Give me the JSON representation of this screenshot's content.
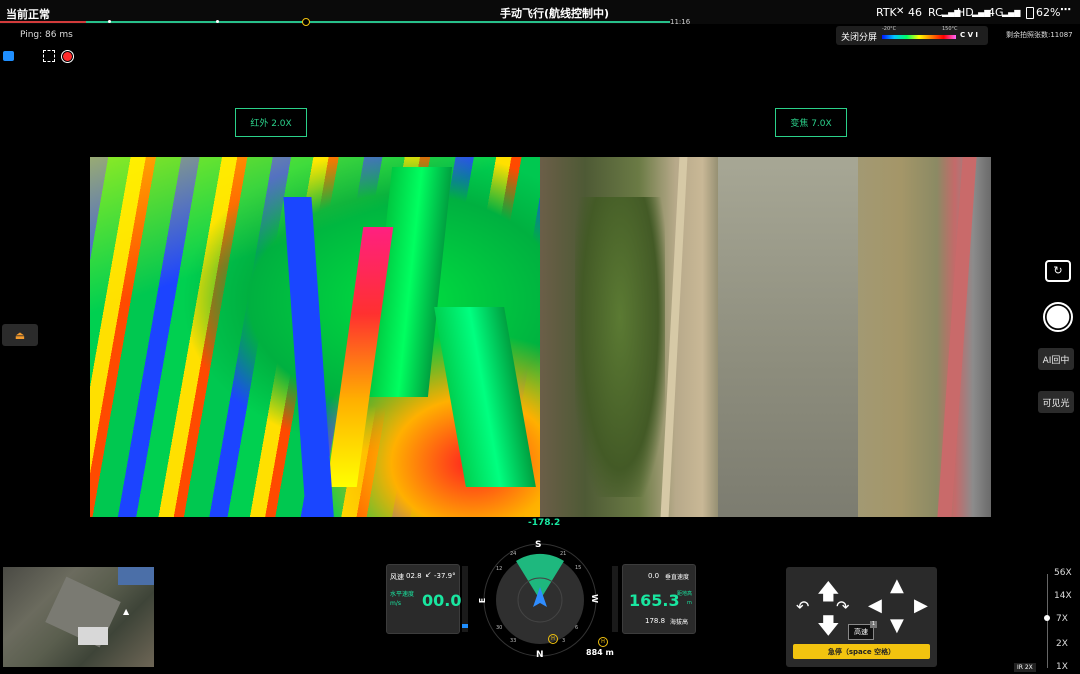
{
  "status_bar": {
    "status": "当前正常",
    "mode_title": "手动飞行(航线控制中)",
    "time_tag": "11:16",
    "rtk_label": "RTK",
    "rtk_count": "46",
    "rc_label": "RC",
    "hd_label": "HD",
    "net_label": "4G",
    "battery": "62%",
    "menu_icon": "more-dots-icon"
  },
  "ping": "Ping: 86 ms",
  "split_toggle": "关闭分屏",
  "temp_scale": {
    "min": "-20°C",
    "max": "150°C",
    "suffix": "C V I"
  },
  "remaining_shots": "剩余拍照张数:11087",
  "left_tools": {
    "camera_icon": "camera-icon",
    "focus_icon": "focus-frame-icon",
    "record_icon": "record-icon"
  },
  "ir_label": "红外 2.0X",
  "zoom_label": "变焦 7.0X",
  "right_controls": {
    "switch_icon": "camera-switch-icon",
    "shutter_icon": "shutter-icon",
    "center_btn": "AI回中",
    "visible_btn": "可见光"
  },
  "heading_readout": "-178.2",
  "left_telemetry": {
    "wind_label": "风速",
    "wind_value": "02.8",
    "wind_dir": "-37.9°",
    "hspeed_label": "水平速度",
    "hspeed_unit": "m/s",
    "hspeed_value": "00.0"
  },
  "right_telemetry": {
    "vspeed_value": "0.0",
    "vspeed_label": "垂直速度",
    "rel_alt_value": "165.3",
    "rel_alt_label": "距地高",
    "rel_alt_unit": "m",
    "asl_value": "178.8",
    "asl_label": "海拔高"
  },
  "compass": {
    "n": "N",
    "s": "S",
    "e": "E",
    "w": "W",
    "ticks_top": [
      "24",
      "21",
      "15",
      "12"
    ],
    "ticks_bottom": [
      "33",
      "30",
      "6",
      "3"
    ],
    "home_distance": "884 m"
  },
  "control_pad": {
    "speed_mode": "高速",
    "badge": "1",
    "pause_button": "急停（space 空格）"
  },
  "zoom_scale": {
    "levels": [
      "56X",
      "14X",
      "7X",
      "2X",
      "1X"
    ],
    "ir_tag": "IR 2X"
  },
  "colors": {
    "accent": "#19e6a0",
    "warning": "#f2c30f",
    "record": "#ff2b2b",
    "box": "#2bd18a"
  }
}
